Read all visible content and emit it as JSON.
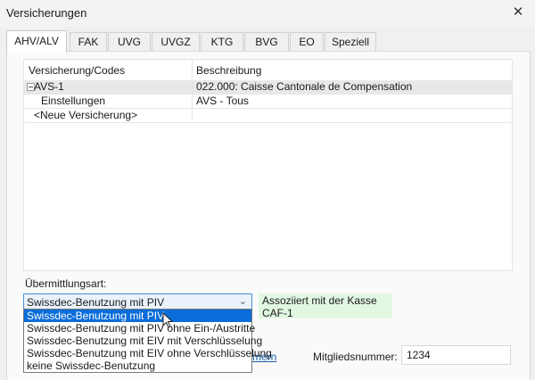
{
  "window": {
    "title": "Versicherungen",
    "close_glyph": "✕"
  },
  "tabs": [
    {
      "label": "AHV/ALV",
      "active": true
    },
    {
      "label": "FAK"
    },
    {
      "label": "UVG"
    },
    {
      "label": "UVGZ"
    },
    {
      "label": "KTG"
    },
    {
      "label": "BVG"
    },
    {
      "label": "EO"
    },
    {
      "label": "Speziell"
    }
  ],
  "grid": {
    "headers": {
      "code": "Versicherung/Codes",
      "description": "Beschreibung"
    },
    "rows": [
      {
        "code": "AVS-1",
        "description": "022.000: Caisse Cantonale de Compensation",
        "selected": true,
        "expander": "collapse"
      },
      {
        "code": "Einstellungen",
        "description": "AVS - Tous"
      },
      {
        "code": "<Neue Versicherung>",
        "description": ""
      }
    ]
  },
  "transmission": {
    "label": "Übermittlungsart:",
    "selected": "Swissdec-Benutzung mit PIV",
    "options": [
      "Swissdec-Benutzung mit PIV",
      "Swissdec-Benutzung mit PIV ohne Ein-/Austritte",
      "Swissdec-Benutzung mit EIV mit Verschlüsselung",
      "Swissdec-Benutzung mit EIV ohne Verschlüsselung",
      "keine Swissdec-Benutzung"
    ],
    "highlighted_index": 0
  },
  "association": {
    "line1": "Assoziiert mit der Kasse",
    "line2": "CAF-1"
  },
  "partial_link": "mern",
  "member": {
    "label": "Mitgliedsnummer:",
    "value": "1234"
  },
  "colors": {
    "accent": "#0a6dd9",
    "association_bg": "#e2f7e2",
    "selected_row": "#e8e8e8"
  }
}
